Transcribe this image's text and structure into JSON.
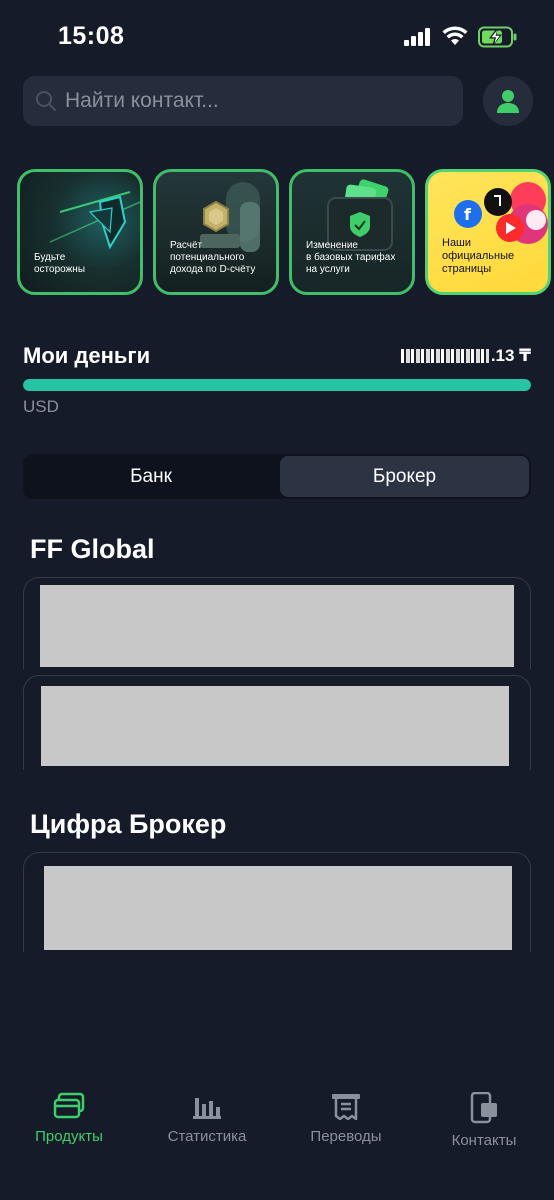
{
  "status_bar": {
    "time": "15:08"
  },
  "search": {
    "placeholder": "Найти контакт..."
  },
  "stories": [
    {
      "label": "Будьте\nосторожны"
    },
    {
      "label": "Расчёт\nпотенциального\nдохода по D-счёту"
    },
    {
      "label": "Изменение\nв базовых тарифах\nна услуги"
    },
    {
      "label": "Наши\nофициальные\nстраницы"
    }
  ],
  "money": {
    "title": "Мои деньги",
    "amount_suffix": ".13 ₸",
    "currency": "USD",
    "progress": 1.0
  },
  "segmented": {
    "bank_label": "Банк",
    "broker_label": "Брокер",
    "selected": "Брокер"
  },
  "sections": [
    {
      "title": "FF Global"
    },
    {
      "title": "Цифра Брокер"
    }
  ],
  "bottom_nav": {
    "items": [
      {
        "label": "Продукты",
        "icon": "cards-icon",
        "active": true
      },
      {
        "label": "Статистика",
        "icon": "bar-chart-icon",
        "active": false
      },
      {
        "label": "Переводы",
        "icon": "receipt-icon",
        "active": false
      },
      {
        "label": "Контакты",
        "icon": "contacts-icon",
        "active": false
      }
    ]
  },
  "colors": {
    "accent": "#3fcf6a",
    "teal_bar": "#25c4a5",
    "background": "#151b29"
  }
}
